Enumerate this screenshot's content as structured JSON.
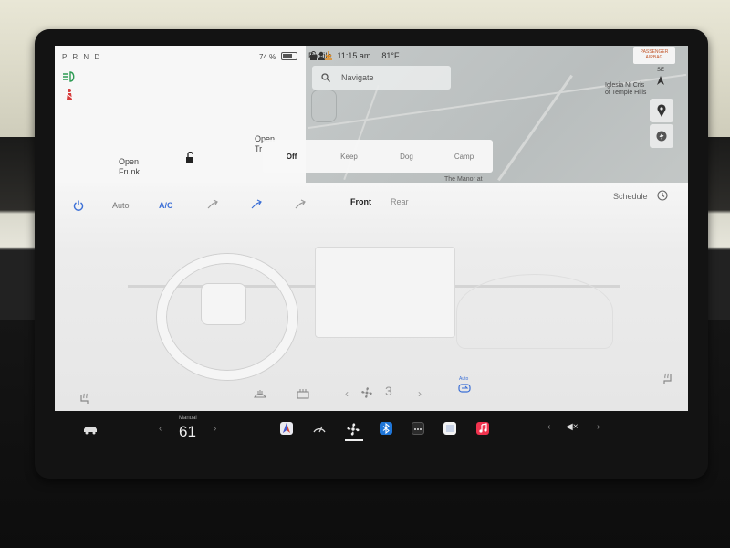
{
  "status": {
    "gear": "P R N D",
    "battery_pct": "74 %",
    "battery_level": 0.74,
    "time": "11:15 am",
    "temp_outside": "81°F",
    "profile_label": "Profile",
    "airbag_line1": "PASSENGER",
    "airbag_line2": "AIRBAG"
  },
  "car": {
    "open_frunk_1": "Open",
    "open_frunk_2": "Frunk",
    "open_trunk_1": "Open",
    "open_trunk_2": "Tr"
  },
  "map": {
    "search_placeholder": "Navigate",
    "place1_line1": "Iglesia Ni Cris",
    "place1_line2": "of Temple Hills",
    "place2": "The Manor at",
    "compass": "SE"
  },
  "climate_modes": [
    "Off",
    "Keep",
    "Dog",
    "Camp"
  ],
  "climate": {
    "auto": "Auto",
    "ac": "A/C",
    "front": "Front",
    "rear": "Rear",
    "schedule": "Schedule",
    "fan_speed": "3",
    "recirc_label": "Auto"
  },
  "taskbar": {
    "temp_mode": "Manual",
    "temp_value": "61",
    "left_arrow": "‹",
    "right_arrow": "›",
    "volume_mute": "◀×"
  },
  "colors": {
    "accent_blue": "#3b6fd6",
    "bluetooth_blue": "#1f76d8",
    "music_red": "#f0334e",
    "seatbelt_red": "#d63b3b",
    "light_green": "#2e9c54"
  }
}
